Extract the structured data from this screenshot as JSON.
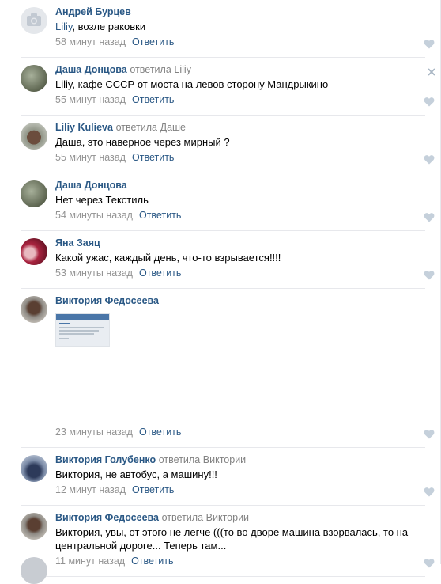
{
  "comments": [
    {
      "author": "Андрей Бурцев",
      "replied_word": "",
      "replied_to": "",
      "mention": "Liliy",
      "text": ", возле раковки",
      "time": "58 минут назад",
      "reply": "Ответить",
      "avatar": "camera-placeholder"
    },
    {
      "author": "Даша Донцова",
      "replied_word": "ответила",
      "replied_to": "Liliy",
      "mention": "",
      "text": "Liliy, кафе СССР от моста на левов сторону Мандрыкино",
      "time": "55 минут назад",
      "reply": "Ответить",
      "avatar": "photo"
    },
    {
      "author": "Liliy Kulieva",
      "replied_word": "ответила",
      "replied_to": "Даше",
      "mention": "",
      "text": "Даша, это наверное через мирный ?",
      "time": "55 минут назад",
      "reply": "Ответить",
      "avatar": "photo"
    },
    {
      "author": "Даша Донцова",
      "replied_word": "",
      "replied_to": "",
      "mention": "",
      "text": "Нет через Текстиль",
      "time": "54 минуты назад",
      "reply": "Ответить",
      "avatar": "photo"
    },
    {
      "author": "Яна Заяц",
      "replied_word": "",
      "replied_to": "",
      "mention": "",
      "text": "Какой ужас, каждый день, что-то взрывается!!!!",
      "time": "53 минуты назад",
      "reply": "Ответить",
      "avatar": "photo"
    },
    {
      "author": "Виктория Федосеева",
      "replied_word": "",
      "replied_to": "",
      "mention": "",
      "text": "",
      "time": "23 минуты назад",
      "reply": "Ответить",
      "avatar": "photo"
    },
    {
      "author": "Виктория Голубенко",
      "replied_word": "ответила",
      "replied_to": "Виктории",
      "mention": "",
      "text": "Виктория, не автобус, а машину!!!",
      "time": "12 минут назад",
      "reply": "Ответить",
      "avatar": "photo"
    },
    {
      "author": "Виктория Федосеева",
      "replied_word": "ответила",
      "replied_to": "Виктории",
      "mention": "",
      "text": "Виктория, увы, от этого не легче (((то во дворе машина взорвалась, то на центральной дороге... Теперь там...",
      "time": "11 минут назад",
      "reply": "Ответить",
      "avatar": "photo"
    }
  ],
  "colors": {
    "link": "#2a5885",
    "meta": "#939393",
    "divider": "#e7e8ec",
    "icon": "#c5d0db"
  }
}
